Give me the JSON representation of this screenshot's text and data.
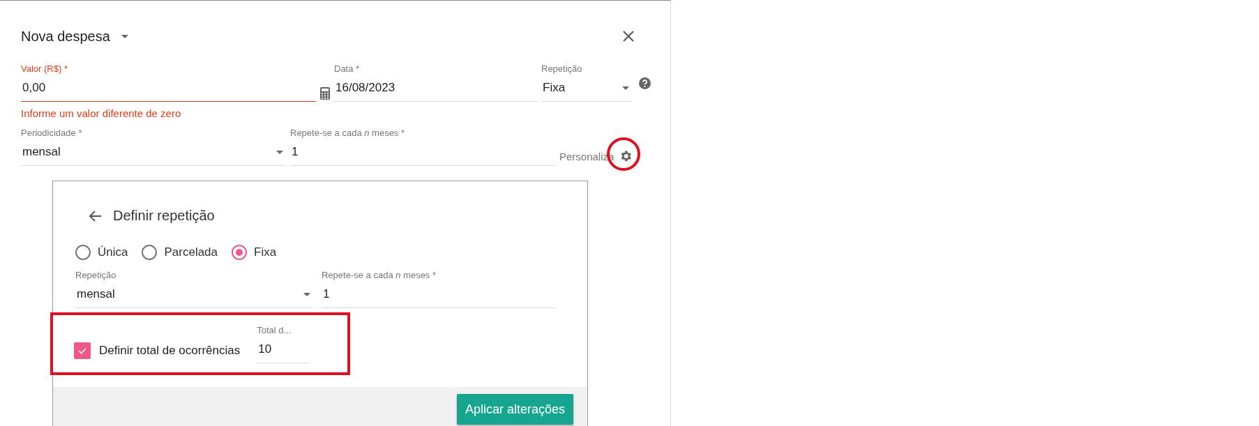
{
  "dialog": {
    "title": "Nova despesa"
  },
  "row_1": [
    {
      "kind": "text",
      "label": "Valor (R$) *",
      "value": "0,00",
      "error": "Informe um valor diferente de zero"
    },
    {
      "kind": "text",
      "label": "Data *",
      "value": "16/08/2023"
    },
    {
      "kind": "select",
      "label": "Repetição",
      "value": "Fixa"
    }
  ],
  "row_2": [
    {
      "kind": "select",
      "label": "Periodicidade *",
      "value": "mensal"
    },
    {
      "kind": "text",
      "label": "Repete-se a cada *n* meses *",
      "value": "1"
    }
  ],
  "customize": {
    "label": "Personaliza",
    "highlighted": true
  },
  "panel": {
    "title": "Definir repetição",
    "options": [
      {
        "label": "Única",
        "selected": false
      },
      {
        "label": "Parcelada",
        "selected": false
      },
      {
        "label": "Fixa",
        "selected": true
      }
    ],
    "fields": [
      {
        "kind": "select",
        "label": "Repetição",
        "value": "mensal"
      },
      {
        "kind": "text",
        "label": "Repete-se a cada *n* meses *",
        "value": "1"
      }
    ],
    "occurrences": {
      "label": "Definir total de ocorrências",
      "checked": true,
      "field_label": "Total d...",
      "value": "10",
      "highlighted": true
    },
    "apply_button": "Aplicar alterações"
  }
}
